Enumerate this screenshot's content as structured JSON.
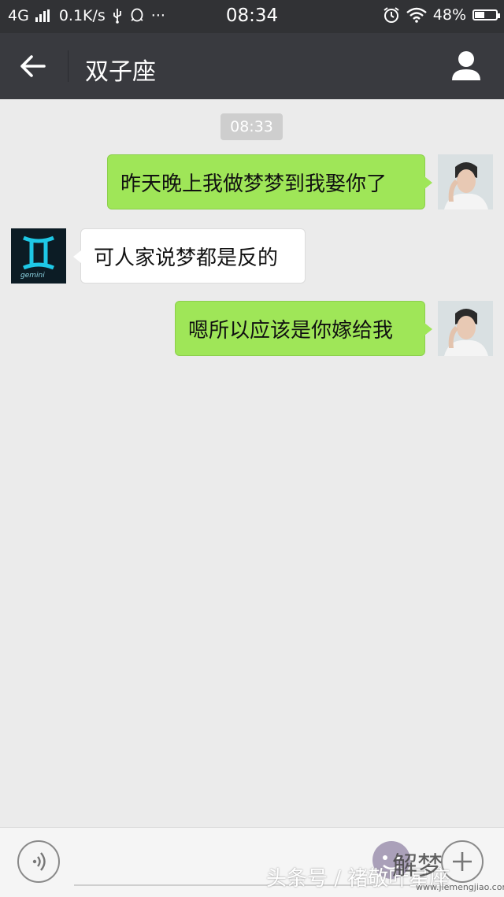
{
  "status_bar": {
    "network": "4G",
    "speed": "0.1K/s",
    "more": "···",
    "time": "08:34",
    "battery": "48%",
    "battery_level": 0.48
  },
  "header": {
    "title": "双子座",
    "back_icon": "back-arrow-icon",
    "profile_icon": "person-icon"
  },
  "chat": {
    "timestamp": "08:33",
    "messages": [
      {
        "side": "out",
        "text": "昨天晚上我做梦梦到我娶你了"
      },
      {
        "side": "in",
        "text": "可人家说梦都是反的"
      },
      {
        "side": "out",
        "text": "嗯所以应该是你嫁给我"
      }
    ]
  },
  "contact_avatar_text": "gemini",
  "input_bar": {
    "voice_icon": "voice-icon",
    "emoji_icon": "emoji-icon",
    "plus_icon": "plus-icon"
  },
  "watermark": {
    "line1": "头条号 / 褚敬叶星座",
    "line2": "解梦",
    "site": "www.jiemengjiao.com"
  },
  "colors": {
    "status_bg": "#313235",
    "header_bg": "#393a3f",
    "chat_bg": "#ebebeb",
    "bubble_out": "#9fe658",
    "bubble_in": "#ffffff"
  }
}
